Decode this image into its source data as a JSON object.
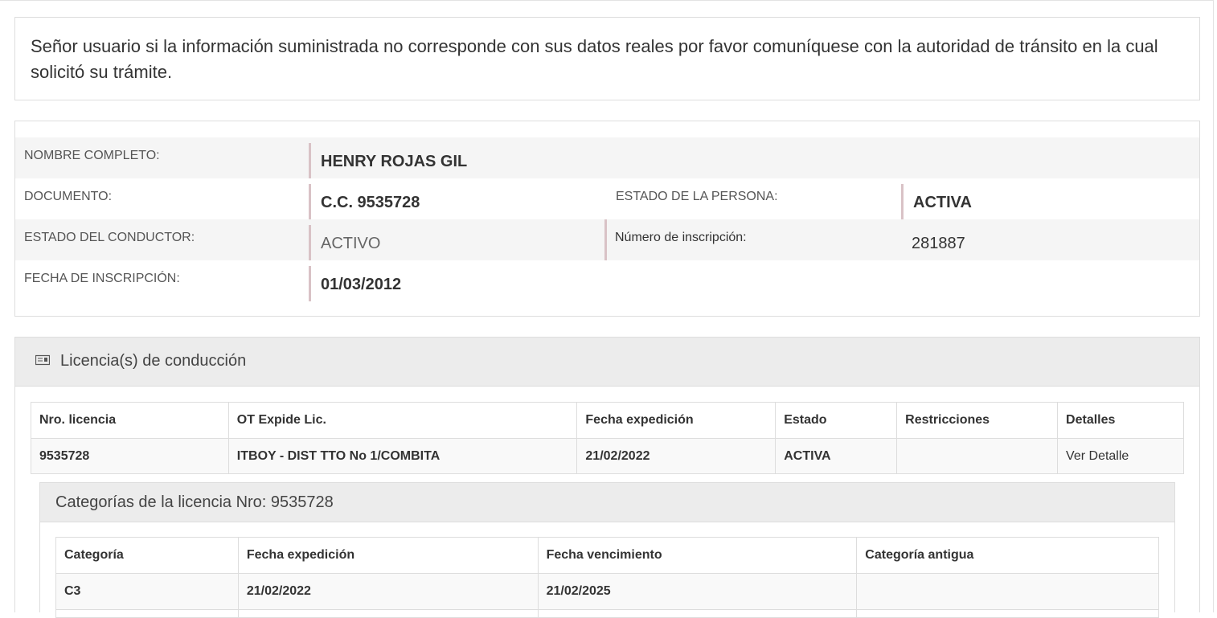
{
  "notice": {
    "text": "Señor usuario si la información suministrada no corresponde con sus datos reales por favor comuníquese con la autoridad de tránsito en la cual solicitó su trámite."
  },
  "person": {
    "nombre_label": "NOMBRE COMPLETO:",
    "nombre_value": "HENRY ROJAS GIL",
    "documento_label": "DOCUMENTO:",
    "documento_value": "C.C. 9535728",
    "estado_persona_label": "ESTADO DE LA PERSONA:",
    "estado_persona_value": "ACTIVA",
    "estado_conductor_label": "ESTADO DEL CONDUCTOR:",
    "estado_conductor_value": "ACTIVO",
    "numero_inscripcion_label": "Número de inscripción:",
    "numero_inscripcion_value": "281887",
    "fecha_inscripcion_label": "FECHA DE INSCRIPCIÓN:",
    "fecha_inscripcion_value": "01/03/2012"
  },
  "licencias": {
    "title": "Licencia(s) de conducción",
    "icon": "id-card-icon",
    "columns": [
      "Nro. licencia",
      "OT Expide Lic.",
      "Fecha expedición",
      "Estado",
      "Restricciones",
      "Detalles"
    ],
    "rows": [
      {
        "nro": "9535728",
        "ot": "ITBOY - DIST TTO No 1/COMBITA",
        "fecha": "21/02/2022",
        "estado": "ACTIVA",
        "restricciones": "",
        "detalles": "Ver Detalle"
      }
    ]
  },
  "categorias": {
    "title": "Categorías de la licencia Nro: 9535728",
    "columns": [
      "Categoría",
      "Fecha expedición",
      "Fecha vencimiento",
      "Categoría antigua"
    ],
    "rows": [
      {
        "categoria": "C3",
        "expedicion": "21/02/2022",
        "vencimiento": "21/02/2025",
        "antigua": ""
      }
    ]
  },
  "colors": {
    "accent_bar": "#d9c2c6",
    "stripe": "#f5f5f5",
    "panel_header": "#ececec",
    "border": "#dddddd"
  }
}
